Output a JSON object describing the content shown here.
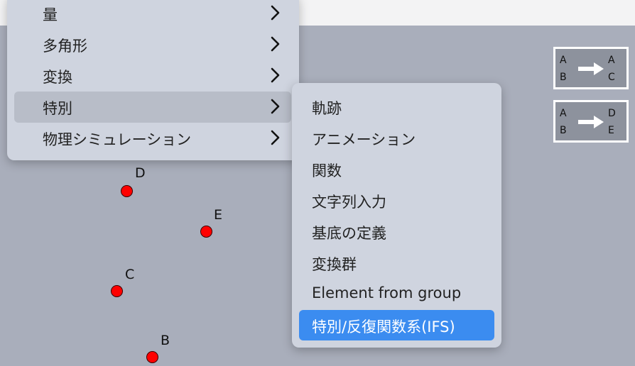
{
  "menu": {
    "items": [
      {
        "label": "量"
      },
      {
        "label": "多角形"
      },
      {
        "label": "変換"
      },
      {
        "label": "特別"
      },
      {
        "label": "物理シミュレーション"
      }
    ]
  },
  "submenu": {
    "items": [
      {
        "label": "軌跡"
      },
      {
        "label": "アニメーション"
      },
      {
        "label": "関数"
      },
      {
        "label": "文字列入力"
      },
      {
        "label": "基底の定義"
      },
      {
        "label": "変換群"
      },
      {
        "label": "Element from group"
      },
      {
        "label": "特別/反復関数系(IFS)"
      }
    ]
  },
  "tools": [
    {
      "left_top": "A",
      "left_bottom": "B",
      "right_top": "A",
      "right_bottom": "C"
    },
    {
      "left_top": "A",
      "left_bottom": "B",
      "right_top": "D",
      "right_bottom": "E"
    }
  ],
  "points": [
    {
      "label": "D"
    },
    {
      "label": "E"
    },
    {
      "label": "C"
    },
    {
      "label": "B"
    }
  ],
  "colors": {
    "menu_bg": "#cfd4df",
    "highlight": "#b8bdc8",
    "active": "#3b8cf0",
    "canvas": "#a9aebb",
    "point": "#ff0000"
  }
}
